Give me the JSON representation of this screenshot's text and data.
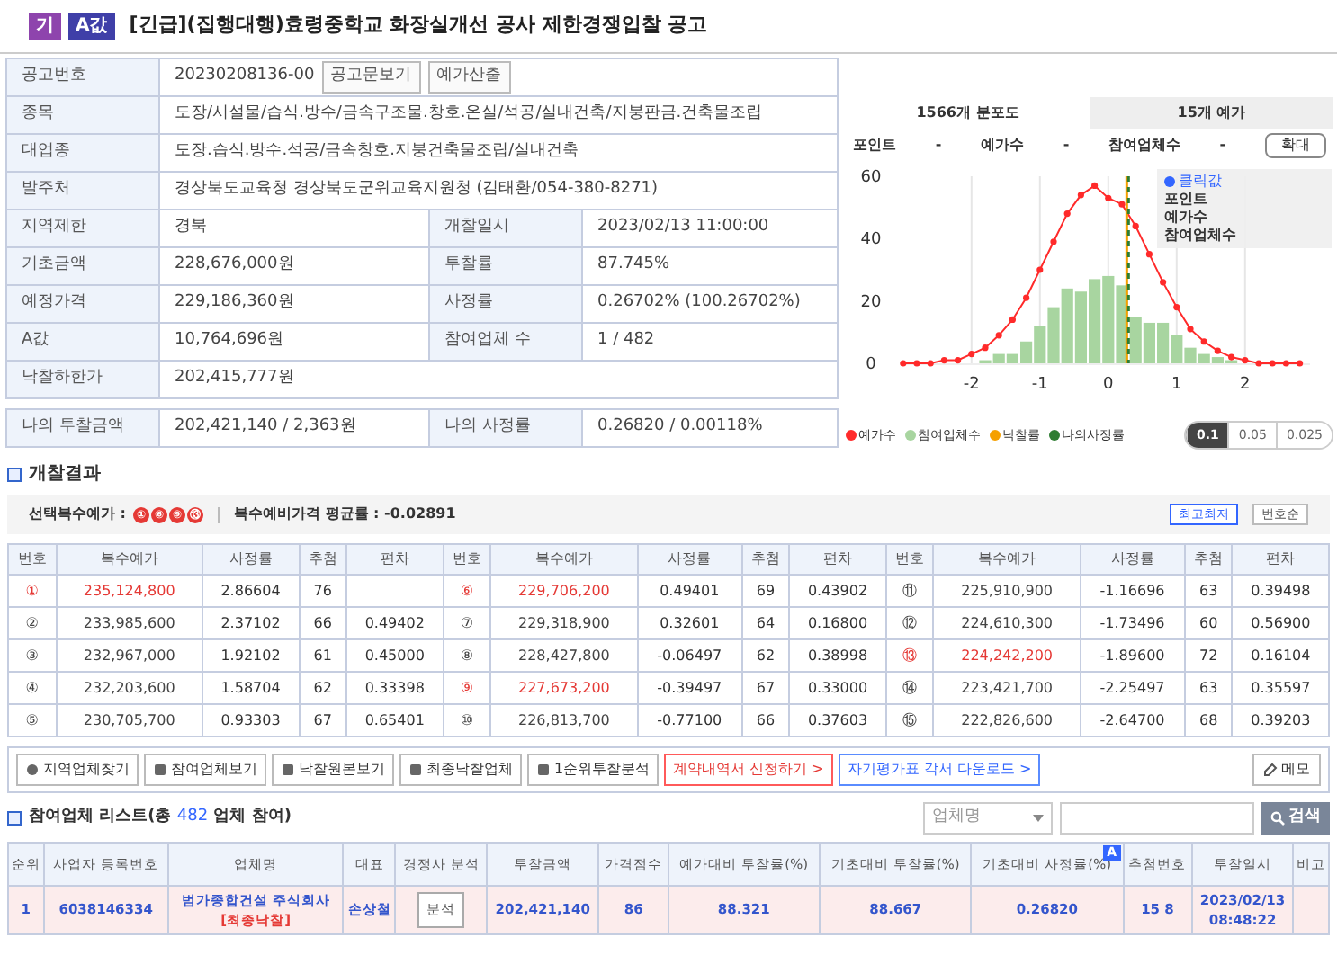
{
  "header": {
    "badges": [
      {
        "text": "기",
        "color": "#8e44ad"
      },
      {
        "text": "A값",
        "color": "#3f3fa8"
      }
    ],
    "title": "[긴급](집행대행)효령중학교 화장실개선 공사 제한경쟁입찰 공고"
  },
  "info": {
    "notice": {
      "label": "공고번호",
      "value": "20230208136-00",
      "buttons": [
        "공고문보기",
        "예가산출"
      ]
    },
    "wide_rows": [
      {
        "label": "종목",
        "value": "도장/시설물/습식.방수/금속구조물.창호.온실/석공/실내건축/지붕판금.건축물조립"
      },
      {
        "label": "대업종",
        "value": "도장.습식.방수.석공/금속창호.지붕건축물조립/실내건축"
      },
      {
        "label": "발주처",
        "value": "경상북도교육청 경상북도군위교육지원청 (김태환/054-380-8271)"
      }
    ],
    "pair_rows": [
      {
        "label": "지역제한",
        "value": "경북",
        "label_2": "개찰일시",
        "value_2": "2023/02/13 11:00:00"
      },
      {
        "label": "기초금액",
        "value": "228,676,000원",
        "label_2": "투찰률",
        "value_2": "87.745%"
      },
      {
        "label": "예정가격",
        "value": "229,186,360원",
        "label_2": "사정률",
        "value_2": "0.26702% (100.26702%)"
      },
      {
        "label": "A값",
        "value": "10,764,696원",
        "label_2": "참여업체 수",
        "value_2": "1 / 482"
      }
    ],
    "floor": {
      "label": "낙찰하한가",
      "value": "202,415,777원"
    },
    "mine": {
      "label": "나의 투찰금액",
      "value": "202,421,140 / 2,363원",
      "label_2": "나의 사정률",
      "value_2": "0.26820 / 0.00118%"
    }
  },
  "chart_panel": {
    "tabs": [
      {
        "label": "1566개 분포도",
        "selected": true
      },
      {
        "label": "15개 예가",
        "selected": false
      }
    ],
    "stats": [
      {
        "label": "포인트",
        "value": "-"
      },
      {
        "label": "예가수",
        "value": "-"
      },
      {
        "label": "참여업체수",
        "value": "-"
      }
    ],
    "zoom_button": "확대",
    "tooltip": {
      "title": "클릭값",
      "lines": [
        "포인트",
        "예가수",
        "참여업체수"
      ]
    },
    "chart_data": {
      "type": "bar",
      "grid": true,
      "x": [
        -3.0,
        -2.8,
        -2.6,
        -2.4,
        -2.2,
        -2.0,
        -1.8,
        -1.6,
        -1.4,
        -1.2,
        -1.0,
        -0.8,
        -0.6,
        -0.4,
        -0.2,
        0.0,
        0.2,
        0.4,
        0.6,
        0.8,
        1.0,
        1.2,
        1.4,
        1.6,
        1.8,
        2.0,
        2.2,
        2.4,
        2.6,
        2.8
      ],
      "series": [
        {
          "name": "예가수",
          "type": "line",
          "marker": "circle",
          "color": "#ff2a2a",
          "values": [
            0,
            0,
            0,
            1,
            1,
            3,
            5,
            9,
            14,
            21,
            30,
            39,
            48,
            54,
            57,
            53,
            51,
            44,
            35,
            26,
            18,
            11,
            7,
            4,
            2,
            1,
            0,
            0,
            0,
            0
          ]
        },
        {
          "name": "참여업체수",
          "color": "#a8d5a0",
          "values": [
            0,
            0,
            0,
            0,
            0,
            0,
            1,
            3,
            3,
            7,
            12,
            18,
            24,
            23,
            27,
            28,
            25,
            15,
            13,
            13,
            9,
            5,
            3,
            2,
            1,
            0,
            0,
            0,
            0,
            0
          ]
        }
      ],
      "xlim": [
        -3.05,
        2.95
      ],
      "ylim": [
        0,
        60
      ],
      "xticks": [
        -2,
        -1,
        0,
        1,
        2
      ],
      "yticks": [
        0,
        20,
        40,
        60
      ],
      "ref_lines": [
        {
          "axis": "x",
          "value": 0.27,
          "label": "낙찰률",
          "color": "#f5a000"
        },
        {
          "axis": "x",
          "value": 0.27,
          "label": "나의사정률",
          "color": "#2e7d32"
        }
      ]
    },
    "steps": [
      {
        "label": "0.1",
        "selected": true
      },
      {
        "label": "0.05",
        "selected": false
      },
      {
        "label": "0.025",
        "selected": false
      }
    ]
  },
  "results": {
    "title": "개찰결과",
    "selected_label": "선택복수예가 :",
    "selected_marks": [
      "①",
      "⑥",
      "⑨",
      "⑬"
    ],
    "average": "복수예비가격 평균률 : -0.02891",
    "sort_buttons": [
      {
        "label": "최고최저",
        "selected": true
      },
      {
        "label": "번호순",
        "selected": false
      }
    ],
    "columns": [
      "번호",
      "복수예가",
      "사정률",
      "추첨",
      "편차",
      "번호",
      "복수예가",
      "사정률",
      "추첨",
      "편차",
      "번호",
      "복수예가",
      "사정률",
      "추첨",
      "편차"
    ],
    "rows": [
      [
        {
          "no": "①",
          "price": "235,124,800",
          "rate": "2.86604",
          "draw": "76",
          "selected": true
        },
        {
          "no": "⑥",
          "price": "229,706,200",
          "rate": "0.49401",
          "draw": "69",
          "dev": "0.43902",
          "selected": true
        },
        {
          "no": "⑪",
          "price": "225,910,900",
          "rate": "-1.16696",
          "draw": "63",
          "dev": "0.39498",
          "selected": false
        }
      ],
      [
        {
          "no": "②",
          "price": "233,985,600",
          "rate": "2.37102",
          "draw": "66",
          "dev": "0.49402",
          "selected": false
        },
        {
          "no": "⑦",
          "price": "229,318,900",
          "rate": "0.32601",
          "draw": "64",
          "dev": "0.16800",
          "selected": false
        },
        {
          "no": "⑫",
          "price": "224,610,300",
          "rate": "-1.73496",
          "draw": "60",
          "dev": "0.56900",
          "selected": false
        }
      ],
      [
        {
          "no": "③",
          "price": "232,967,000",
          "rate": "1.92102",
          "draw": "61",
          "dev": "0.45000",
          "selected": false
        },
        {
          "no": "⑧",
          "price": "228,427,800",
          "rate": "-0.06497",
          "draw": "62",
          "dev": "0.38998",
          "selected": false
        },
        {
          "no": "⑬",
          "price": "224,242,200",
          "rate": "-1.89600",
          "draw": "72",
          "dev": "0.16104",
          "selected": true
        }
      ],
      [
        {
          "no": "④",
          "price": "232,203,600",
          "rate": "1.58704",
          "draw": "62",
          "dev": "0.33398",
          "selected": false
        },
        {
          "no": "⑨",
          "price": "227,673,200",
          "rate": "-0.39497",
          "draw": "67",
          "dev": "0.33000",
          "selected": true
        },
        {
          "no": "⑭",
          "price": "223,421,700",
          "rate": "-2.25497",
          "draw": "63",
          "dev": "0.35597",
          "selected": false
        }
      ],
      [
        {
          "no": "⑤",
          "price": "230,705,700",
          "rate": "0.93303",
          "draw": "67",
          "dev": "0.65401",
          "selected": false
        },
        {
          "no": "⑩",
          "price": "226,813,700",
          "rate": "-0.77100",
          "draw": "66",
          "dev": "0.37603",
          "selected": false
        },
        {
          "no": "⑮",
          "price": "222,826,600",
          "rate": "-2.64700",
          "draw": "68",
          "dev": "0.39203",
          "selected": false
        }
      ]
    ]
  },
  "toolbar": [
    {
      "label": "지역업체찾기",
      "kind": "globe"
    },
    {
      "label": "참여업체보기",
      "kind": "building"
    },
    {
      "label": "낙찰원본보기",
      "kind": "award"
    },
    {
      "label": "최종낙찰업체",
      "kind": "flag"
    },
    {
      "label": "1순위투찰분석",
      "kind": "rank"
    },
    {
      "label": "계약내역서 신청하기 >",
      "kind": "red"
    },
    {
      "label": "자기평가표 각서 다운로드 >",
      "kind": "blue"
    }
  ],
  "memo_button": "메모",
  "list": {
    "title_start": "참여업체 리스트(총 ",
    "count": "482",
    "title_end": " 업체 참여)",
    "filter_placeholder": "업체명",
    "search_button": "검색",
    "columns": [
      "순위",
      "사업자 등록번호",
      "업체명",
      "대표",
      "경쟁사 분석",
      "투찰금액",
      "가격점수",
      "예가대비 투찰률(%)",
      "기초대비 투찰률(%)",
      "기초대비 사정률(%)",
      "추첨번호",
      "투찰일시",
      "비고"
    ],
    "a_badge": "A",
    "rows": [
      {
        "rank": "1",
        "reg_no": "6038146334",
        "company": "범가종합건설 주식회사",
        "tag": "[최종낙찰]",
        "ceo": "손상철",
        "analyze": "분석",
        "amount": "202,421,140",
        "score": "86",
        "rate_est": "88.321",
        "rate_base": "88.667",
        "adj_rate": "0.26820",
        "draw": "15 8",
        "date": "2023/02/13",
        "time": "08:48:22",
        "highlighted": true
      }
    ]
  }
}
